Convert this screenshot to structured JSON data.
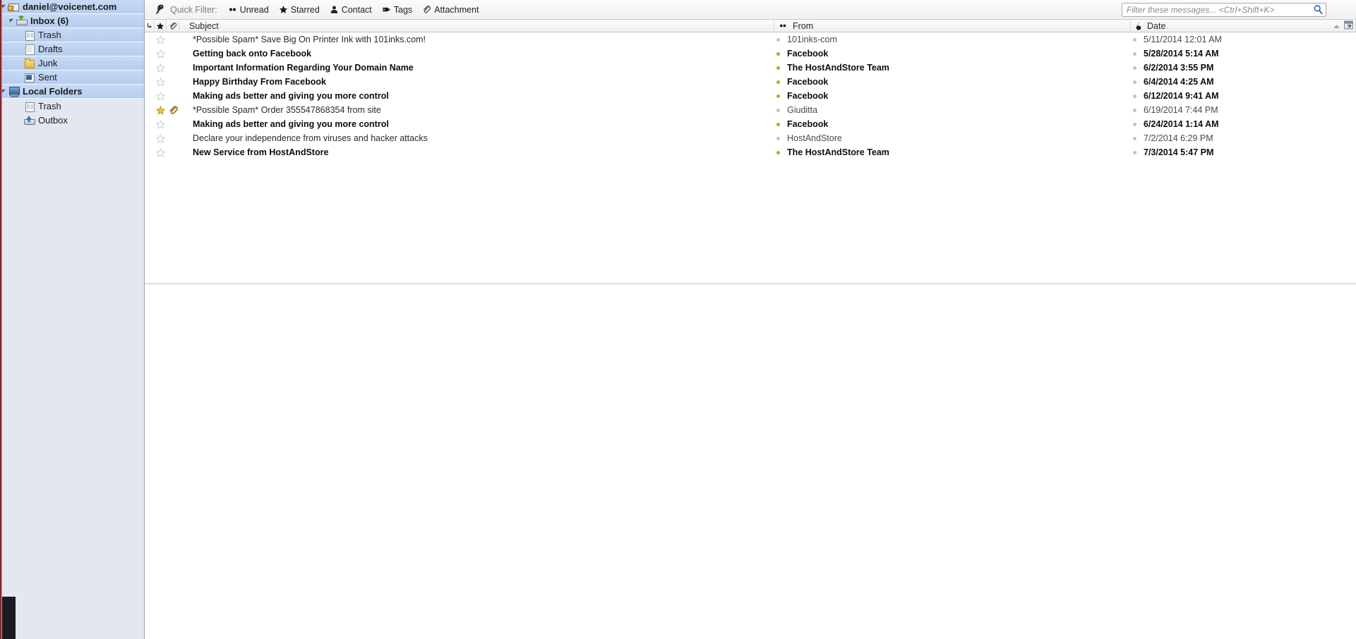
{
  "window": {
    "title": "daniel@voicenet.com",
    "accent_selection": "#b6cdef",
    "sidebar_bg": "#e3e7ef",
    "unread_dot_color": "#86c232",
    "star_color": "#e8b723"
  },
  "sidebar": {
    "account": {
      "label": "daniel@voicenet.com",
      "icon": "account-key-icon",
      "expanded": true
    },
    "items": [
      {
        "label": "Inbox (6)",
        "icon": "inbox-icon",
        "indent": 1,
        "bold": true,
        "selected": true,
        "twisty": true
      },
      {
        "label": "Trash",
        "icon": "trash-icon",
        "indent": 2,
        "bold": false,
        "selected": true,
        "twisty": false
      },
      {
        "label": "Drafts",
        "icon": "drafts-icon",
        "indent": 2,
        "bold": false,
        "selected": true,
        "twisty": false
      },
      {
        "label": "Junk",
        "icon": "junk-folder-icon",
        "indent": 2,
        "bold": false,
        "selected": true,
        "twisty": false
      },
      {
        "label": "Sent",
        "icon": "sent-icon",
        "indent": 2,
        "bold": false,
        "selected": true,
        "twisty": false
      }
    ],
    "local": {
      "label": "Local Folders",
      "icon": "computer-icon",
      "expanded": true,
      "selected": true
    },
    "local_items": [
      {
        "label": "Trash",
        "icon": "trash-icon",
        "indent": 2
      },
      {
        "label": "Outbox",
        "icon": "outbox-icon",
        "indent": 2
      }
    ]
  },
  "quick_filter": {
    "pin_icon": "pin-icon",
    "label": "Quick Filter:",
    "buttons": [
      {
        "label": "Unread",
        "icon": "unread-dots-icon"
      },
      {
        "label": "Starred",
        "icon": "star-icon"
      },
      {
        "label": "Contact",
        "icon": "contact-icon"
      },
      {
        "label": "Tags",
        "icon": "tag-icon"
      },
      {
        "label": "Attachment",
        "icon": "paperclip-icon"
      }
    ]
  },
  "search": {
    "value": "",
    "placeholder": "Filter these messages... <Ctrl+Shift+K>",
    "icon": "search-icon"
  },
  "message_list": {
    "columns": [
      {
        "key": "thread",
        "label": "",
        "icon": "thread-icon"
      },
      {
        "key": "star",
        "label": "",
        "icon": "star-icon"
      },
      {
        "key": "attachment",
        "label": "",
        "icon": "paperclip-icon"
      },
      {
        "key": "subject",
        "label": "Subject",
        "icon": ""
      },
      {
        "key": "from",
        "label": "From",
        "icon": "unread-dots-icon"
      },
      {
        "key": "date",
        "label": "Date",
        "icon": "flame-icon"
      }
    ],
    "sort": {
      "column": "date",
      "direction": "ascending",
      "icon": "sort-asc-icon"
    },
    "column_picker_icon": "column-picker-icon",
    "rows": [
      {
        "subject": "*Possible Spam* Save Big On Printer Ink with 101inks.com!",
        "from": "101inks-com",
        "date": "5/11/2014 12:01 AM",
        "unread": false,
        "starred": false,
        "attachment": false
      },
      {
        "subject": "Getting back onto Facebook",
        "from": "Facebook",
        "date": "5/28/2014 5:14 AM",
        "unread": true,
        "starred": false,
        "attachment": false
      },
      {
        "subject": "Important Information Regarding Your Domain Name",
        "from": "The HostAndStore Team",
        "date": "6/2/2014 3:55 PM",
        "unread": true,
        "starred": false,
        "attachment": false
      },
      {
        "subject": "Happy Birthday From Facebook",
        "from": "Facebook",
        "date": "6/4/2014 4:25 AM",
        "unread": true,
        "starred": false,
        "attachment": false
      },
      {
        "subject": "Making ads better and giving you more control",
        "from": "Facebook",
        "date": "6/12/2014 9:41 AM",
        "unread": true,
        "starred": false,
        "attachment": false
      },
      {
        "subject": "*Possible Spam* Order 355547868354 from site",
        "from": "Giuditta",
        "date": "6/19/2014 7:44 PM",
        "unread": false,
        "starred": true,
        "attachment": true
      },
      {
        "subject": "Making ads better and giving you more control",
        "from": "Facebook",
        "date": "6/24/2014 1:14 AM",
        "unread": true,
        "starred": false,
        "attachment": false
      },
      {
        "subject": "Declare your independence from viruses and hacker attacks",
        "from": "HostAndStore",
        "date": "7/2/2014 6:29 PM",
        "unread": false,
        "starred": false,
        "attachment": false
      },
      {
        "subject": "New Service from HostAndStore",
        "from": "The HostAndStore Team",
        "date": "7/3/2014 5:47 PM",
        "unread": true,
        "starred": false,
        "attachment": false
      }
    ]
  }
}
